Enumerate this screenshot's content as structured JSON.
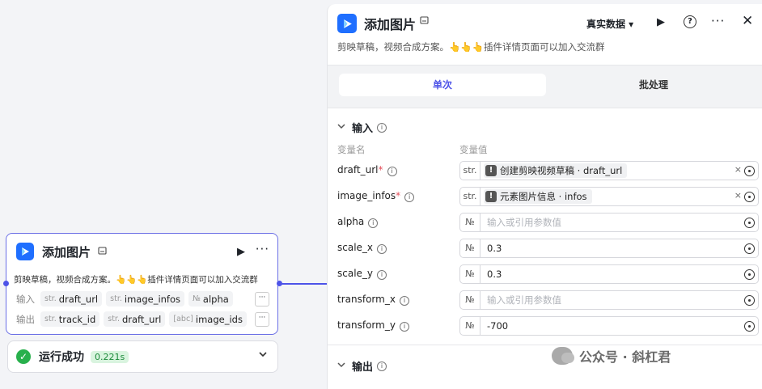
{
  "colors": {
    "accent": "#4d53e8",
    "success": "#28b04c",
    "brand": "#1f6fff"
  },
  "node": {
    "title": "添加图片",
    "ext_icon": "store-icon",
    "run_icon": "play-icon",
    "more": "···",
    "description": "剪映草稿，视频合成方案。👆👆👆插件详情页面可以加入交流群",
    "inputs_label": "输入",
    "outputs_label": "输出",
    "inputs": [
      {
        "type": "str.",
        "name": "draft_url"
      },
      {
        "type": "str.",
        "name": "image_infos"
      },
      {
        "type": "№",
        "name": "alpha"
      }
    ],
    "outputs": [
      {
        "type": "str.",
        "name": "track_id"
      },
      {
        "type": "str.",
        "name": "draft_url"
      },
      {
        "type": "[abc]",
        "name": "image_ids"
      }
    ],
    "port_more": "···"
  },
  "status": {
    "icon": "✓",
    "text": "运行成功",
    "duration": "0.221s",
    "chevron": "⌄"
  },
  "panel": {
    "title": "添加图片",
    "mode": "真实数据 ▾",
    "help": "?",
    "more": "···",
    "close": "✕",
    "description": "剪映草稿，视频合成方案。👆👆👆插件详情页面可以加入交流群",
    "tabs": {
      "single": "单次",
      "batch": "批处理"
    },
    "input_section": {
      "title": "输入",
      "chevron": "⌄",
      "info": "i"
    },
    "col_name": "变量名",
    "col_value": "变量值",
    "params": [
      {
        "name": "draft_url",
        "required": "*",
        "type": "str.",
        "ref": "创建剪映视频草稿 · draft_url"
      },
      {
        "name": "image_infos",
        "required": "*",
        "type": "str.",
        "ref": "元素图片信息 · infos"
      },
      {
        "name": "alpha",
        "required": "",
        "type": "№",
        "value": "",
        "placeholder": "输入或引用参数值"
      },
      {
        "name": "scale_x",
        "required": "",
        "type": "№",
        "value": "0.3",
        "placeholder": "输入或引用参数值"
      },
      {
        "name": "scale_y",
        "required": "",
        "type": "№",
        "value": "0.3",
        "placeholder": "输入或引用参数值"
      },
      {
        "name": "transform_x",
        "required": "",
        "type": "№",
        "value": "",
        "placeholder": "输入或引用参数值"
      },
      {
        "name": "transform_y",
        "required": "",
        "type": "№",
        "value": "-700",
        "placeholder": "输入或引用参数值"
      }
    ],
    "output_section": {
      "title": "输出",
      "chevron": "⌄",
      "info": "i"
    }
  },
  "watermark": {
    "text": "公众号 · 斜杠君"
  }
}
